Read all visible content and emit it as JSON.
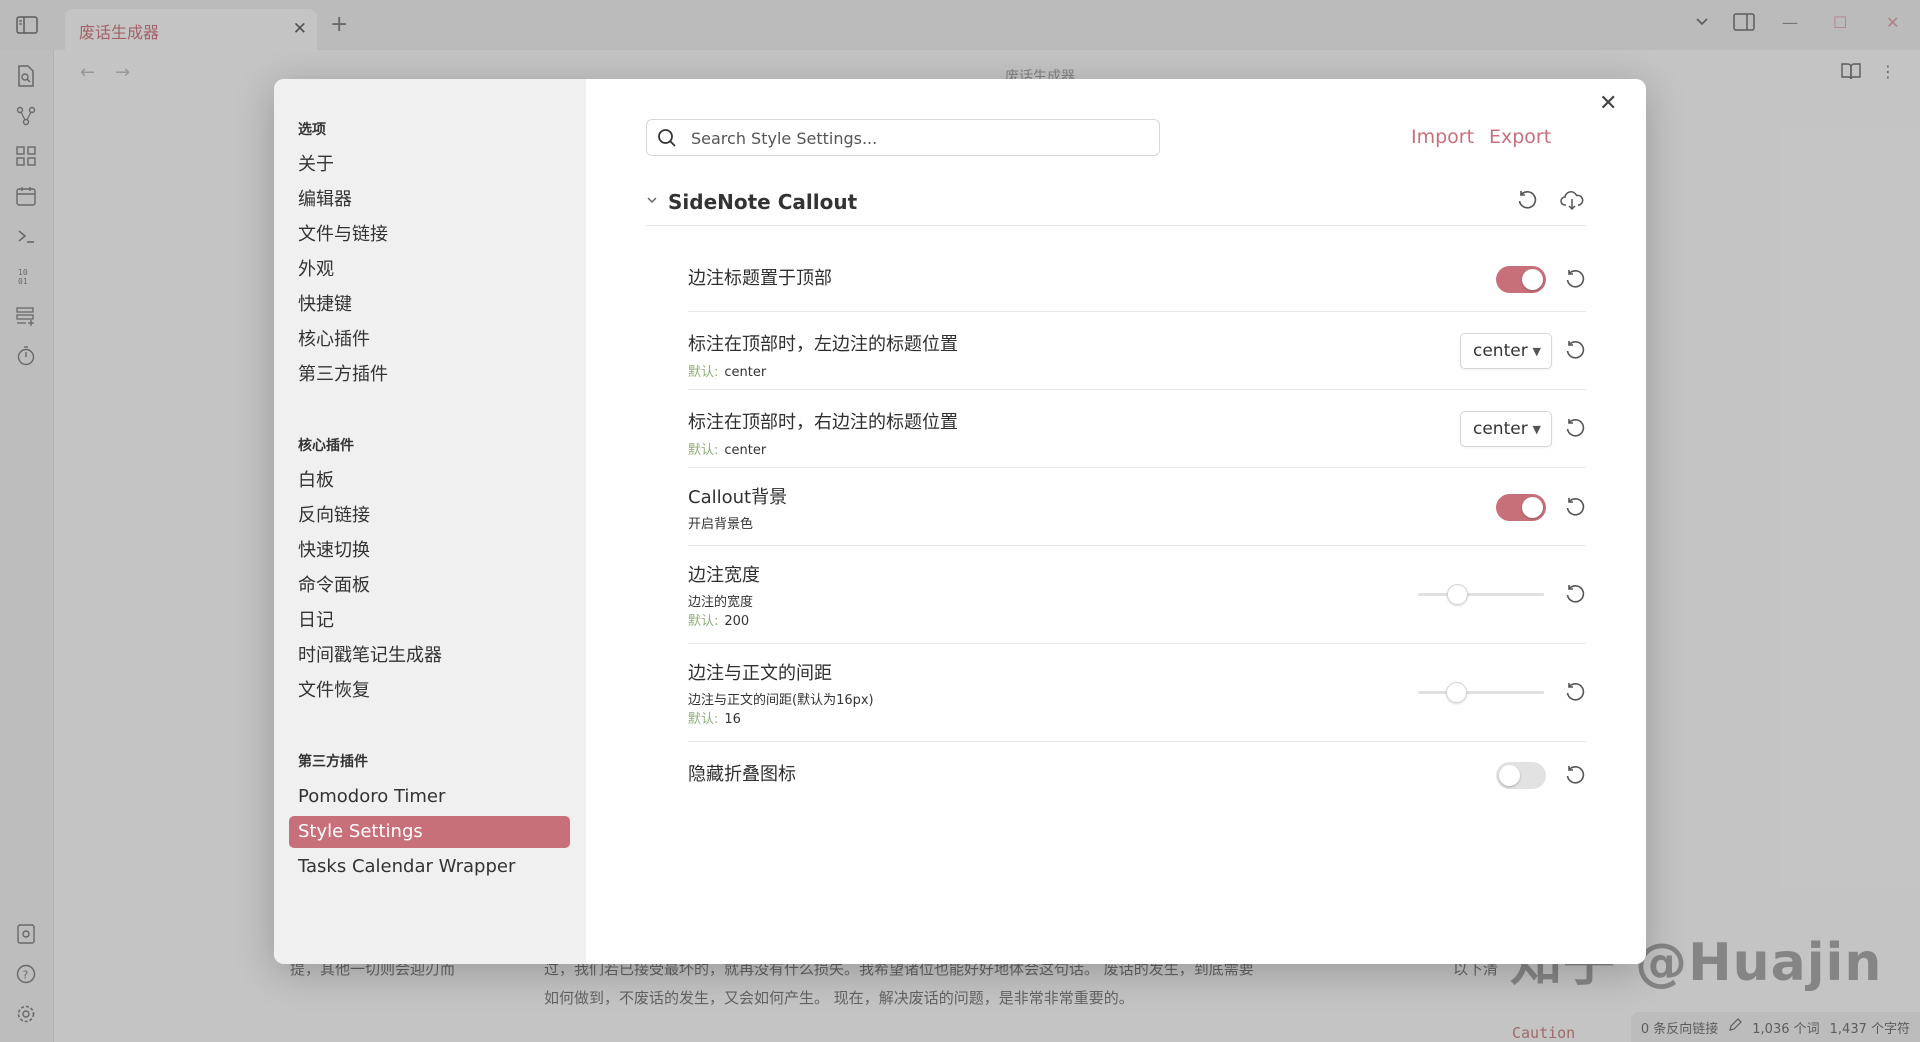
{
  "tab": {
    "title": "废话生成器"
  },
  "view": {
    "title": "废话生成器"
  },
  "background": {
    "lines": [
      "提，其他一切则会迎刃而",
      "过，我们若已接受最坏的，就再没有什么损失。我希望诸位也能好好地体会这句话。 废话的发生，到底需要",
      "如何做到，不废话的发生，又会如何产生。 现在，解决废话的问题，是非常非常重要的。",
      "以下清"
    ],
    "caution": "Caution",
    "watermark": "知乎 @Huajin"
  },
  "statusbar": {
    "backlinks": "0 条反向链接",
    "words": "1,036 个词",
    "chars": "1,437 个字符"
  },
  "settings": {
    "sidebar": {
      "groups": [
        {
          "heading": "选项",
          "items": [
            "关于",
            "编辑器",
            "文件与链接",
            "外观",
            "快捷键",
            "核心插件",
            "第三方插件"
          ]
        },
        {
          "heading": "核心插件",
          "items": [
            "白板",
            "反向链接",
            "快速切换",
            "命令面板",
            "日记",
            "时间戳笔记生成器",
            "文件恢复"
          ]
        },
        {
          "heading": "第三方插件",
          "items": [
            "Pomodoro Timer",
            "Style Settings",
            "Tasks Calendar Wrapper"
          ]
        }
      ],
      "active": "Style Settings"
    },
    "search": {
      "placeholder": "Search Style Settings..."
    },
    "import_label": "Import",
    "export_label": "Export",
    "section": {
      "title": "SideNote Callout"
    },
    "default_label": "默认:",
    "rows": [
      {
        "name": "边注标题置于顶部",
        "control": "toggle",
        "on": true
      },
      {
        "name": "标注在顶部时，左边注的标题位置",
        "default": "center",
        "control": "select",
        "value": "center"
      },
      {
        "name": "标注在顶部时，右边注的标题位置",
        "default": "center",
        "control": "select",
        "value": "center"
      },
      {
        "name": "Callout背景",
        "desc": "开启背景色",
        "control": "toggle",
        "on": true
      },
      {
        "name": "边注宽度",
        "desc": "边注的宽度",
        "default": "200",
        "control": "slider",
        "level": 0.28
      },
      {
        "name": "边注与正文的间距",
        "desc": "边注与正文的间距(默认为16px)",
        "default": "16",
        "control": "slider",
        "level": 0.27
      },
      {
        "name": "隐藏折叠图标",
        "control": "toggle",
        "on": false
      }
    ]
  },
  "colors": {
    "accent": "#c8707a",
    "default_label": "#8fae7a"
  }
}
